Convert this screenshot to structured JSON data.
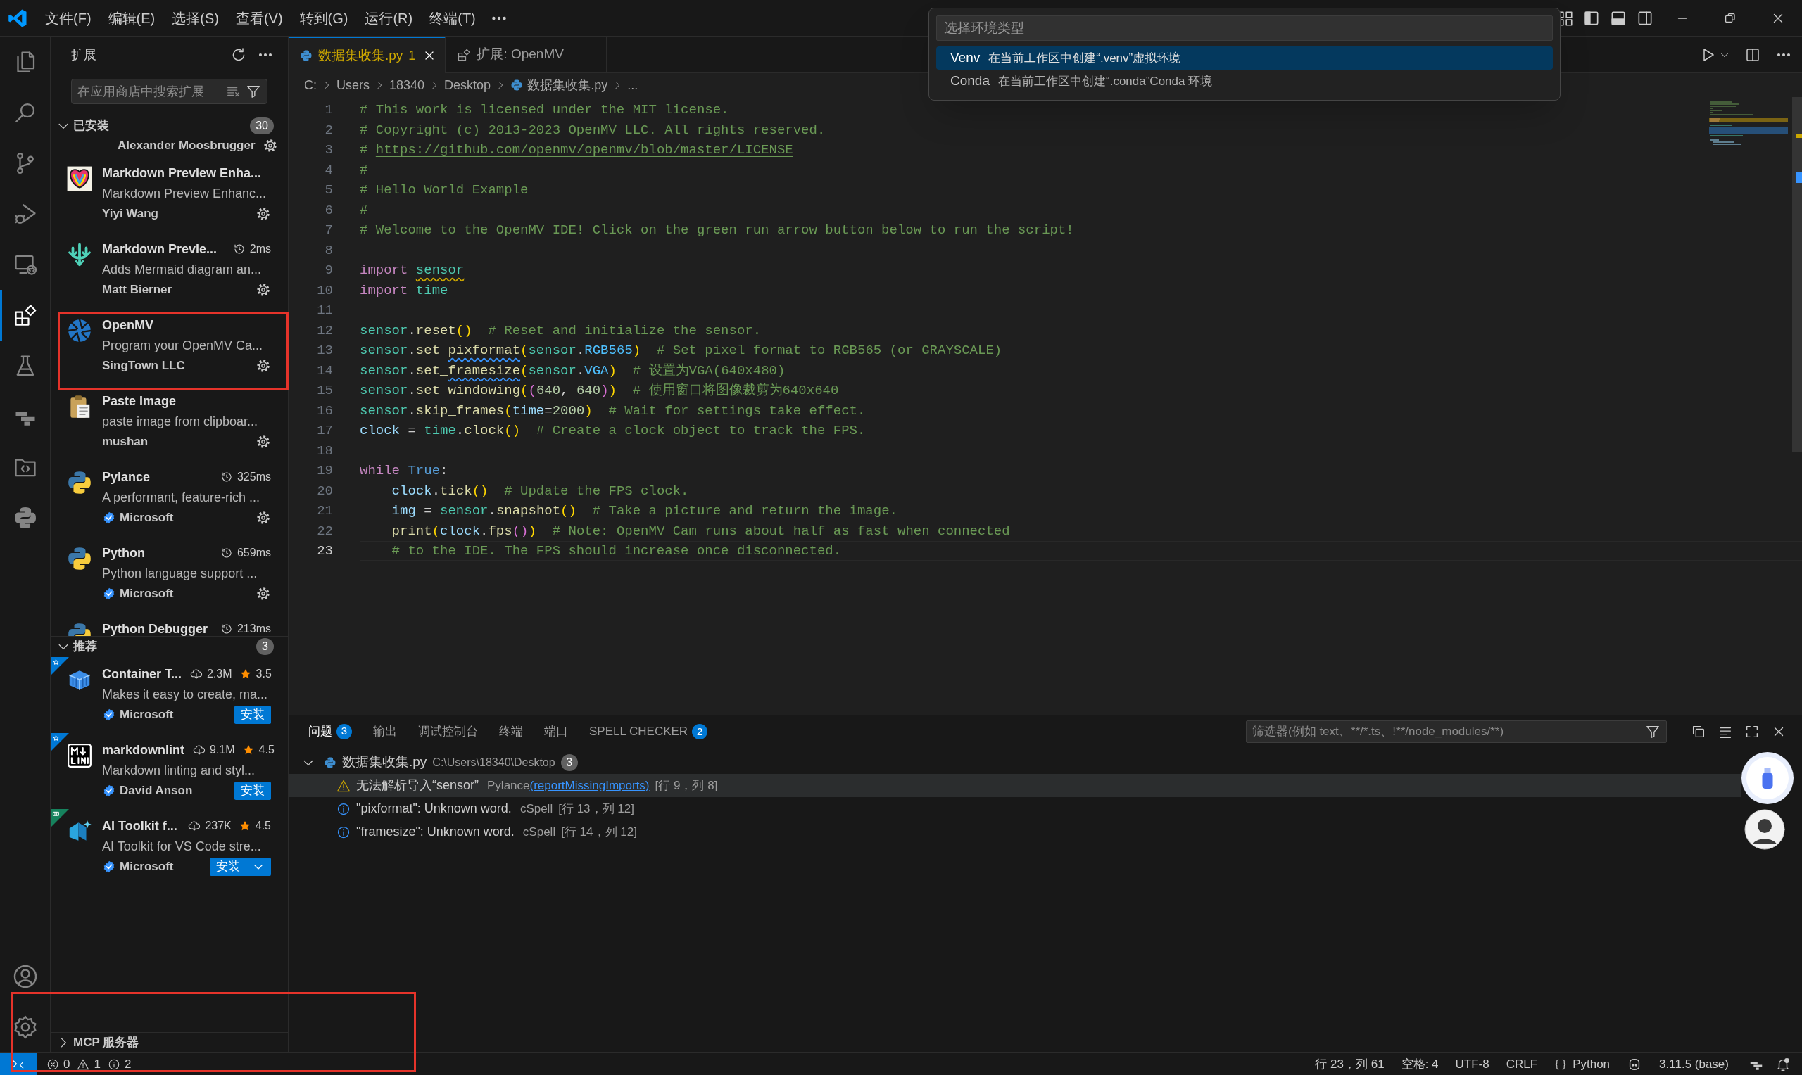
{
  "title_bar": {
    "menu": [
      "文件(F)",
      "编辑(E)",
      "选择(S)",
      "查看(V)",
      "转到(G)",
      "运行(R)",
      "终端(T)"
    ]
  },
  "quick_pick": {
    "placeholder": "选择环境类型",
    "items": [
      {
        "label": "Venv",
        "description": "在当前工作区中创建“.venv”虚拟环境",
        "selected": true
      },
      {
        "label": "Conda",
        "description": "在当前工作区中创建“.conda”Conda 环境",
        "selected": false
      }
    ]
  },
  "activity_bar": {
    "items": [
      {
        "selected": false
      },
      {
        "selected": false
      },
      {
        "selected": false
      },
      {
        "selected": false
      },
      {
        "selected": false
      },
      {
        "selected": true
      },
      {
        "selected": false
      },
      {
        "selected": false
      },
      {
        "selected": false
      },
      {
        "selected": false
      }
    ]
  },
  "sidebar": {
    "title": "扩展",
    "search": {
      "placeholder": "在应用商店中搜索扩展"
    },
    "sections": [
      {
        "title": "已安装",
        "count": "30",
        "expanded": true,
        "items": [
          {
            "publisher": "Alexander Moosbrugger",
            "verified": false,
            "settings": true
          },
          {
            "name": "Markdown Preview Enha...",
            "description": "Markdown Preview Enhanc...",
            "publisher": "Yiyi Wang",
            "verified": false,
            "settings": true
          },
          {
            "name": "Markdown Previe...",
            "time": "2ms",
            "description": "Adds Mermaid diagram an...",
            "publisher": "Matt Bierner",
            "verified": false,
            "settings": true
          },
          {
            "name": "OpenMV",
            "description": "Program your OpenMV Ca...",
            "publisher": "SingTown LLC",
            "verified": false,
            "settings": true
          },
          {
            "name": "Paste Image",
            "description": "paste image from clipboar...",
            "publisher": "mushan",
            "verified": false,
            "settings": true
          },
          {
            "name": "Pylance",
            "time": "325ms",
            "description": "A performant, feature-rich ...",
            "publisher": "Microsoft",
            "verified": true,
            "settings": true
          },
          {
            "name": "Python",
            "time": "659ms",
            "description": "Python language support ...",
            "publisher": "Microsoft",
            "verified": true,
            "settings": true
          },
          {
            "name": "Python Debugger",
            "time": "213ms"
          }
        ]
      },
      {
        "title": "推荐",
        "count": "3",
        "expanded": true,
        "items": [
          {
            "name": "Container T...",
            "downloads": "2.3M",
            "rating": "3.5",
            "description": "Makes it easy to create, ma...",
            "publisher": "Microsoft",
            "verified": true,
            "action": {
              "label": "安装",
              "dropdown": false
            },
            "preview": false
          },
          {
            "name": "markdownlint",
            "downloads": "9.1M",
            "rating": "4.5",
            "description": "Markdown linting and styl...",
            "publisher": "David Anson",
            "verified": true,
            "action": {
              "label": "安装",
              "dropdown": false
            },
            "preview": false
          },
          {
            "name": "AI Toolkit f...",
            "downloads": "237K",
            "rating": "4.5",
            "description": "AI Toolkit for VS Code stre...",
            "publisher": "Microsoft",
            "verified": true,
            "action": {
              "label": "安装",
              "dropdown": true
            },
            "preview": true
          }
        ]
      },
      {
        "title": "MCP 服务器",
        "expanded": false
      }
    ]
  },
  "editor": {
    "tabs": [
      {
        "label": "数据集收集.py",
        "problems": "1",
        "warning": true,
        "selected": true
      },
      {
        "label": "扩展: OpenMV",
        "warning": false,
        "selected": false
      }
    ],
    "breadcrumbs": [
      "C:",
      "Users",
      "18340",
      "Desktop",
      "数据集收集.py",
      "..."
    ],
    "lines": [
      {
        "number": "1",
        "current": false,
        "tokens": [
          {
            "text": "# This work is licensed under the MIT license.",
            "kind": "comment"
          }
        ]
      },
      {
        "number": "2",
        "current": false,
        "tokens": [
          {
            "text": "# Copyright (c) 2013-2023 OpenMV LLC. All rights reserved.",
            "kind": "comment"
          }
        ]
      },
      {
        "number": "3",
        "current": false,
        "tokens": [
          {
            "text": "# ",
            "kind": "comment"
          },
          {
            "text": "https://github.com/openmv/openmv/blob/master/LICENSE",
            "kind": "link"
          }
        ]
      },
      {
        "number": "4",
        "current": false,
        "tokens": [
          {
            "text": "#",
            "kind": "comment"
          }
        ]
      },
      {
        "number": "5",
        "current": false,
        "tokens": [
          {
            "text": "# Hello World Example",
            "kind": "comment"
          }
        ]
      },
      {
        "number": "6",
        "current": false,
        "tokens": [
          {
            "text": "#",
            "kind": "comment"
          }
        ]
      },
      {
        "number": "7",
        "current": false,
        "tokens": [
          {
            "text": "# Welcome to the OpenMV IDE! Click on the green run arrow button below to run the script!",
            "kind": "comment"
          }
        ]
      },
      {
        "number": "8",
        "current": false
      },
      {
        "number": "9",
        "current": false,
        "tokens": [
          {
            "text": "import ",
            "kind": "keyword"
          },
          {
            "text": "sensor",
            "kind": "module",
            "warning": true
          }
        ]
      },
      {
        "number": "10",
        "current": false,
        "tokens": [
          {
            "text": "import ",
            "kind": "keyword"
          },
          {
            "text": "time",
            "kind": "module"
          }
        ]
      },
      {
        "number": "11",
        "current": false
      },
      {
        "number": "12",
        "current": false,
        "tokens": [
          {
            "text": "sensor",
            "kind": "module"
          },
          {
            "text": ".",
            "kind": "plain"
          },
          {
            "text": "reset",
            "kind": "function"
          },
          {
            "text": "()",
            "kind": "bracket"
          },
          {
            "text": "  # Reset and initialize the sensor.",
            "kind": "comment"
          }
        ]
      },
      {
        "number": "13",
        "current": false,
        "tokens": [
          {
            "text": "sensor",
            "kind": "module"
          },
          {
            "text": ".",
            "kind": "plain"
          },
          {
            "text": "set_",
            "kind": "function"
          },
          {
            "text": "pixformat",
            "kind": "function",
            "unknown_word": true
          },
          {
            "text": "(",
            "kind": "bracket"
          },
          {
            "text": "sensor",
            "kind": "module"
          },
          {
            "text": ".",
            "kind": "plain"
          },
          {
            "text": "RGB565",
            "kind": "constant"
          },
          {
            "text": ")",
            "kind": "bracket"
          },
          {
            "text": "  # Set pixel format to RGB565 (or GRAYSCALE)",
            "kind": "comment"
          }
        ]
      },
      {
        "number": "14",
        "current": false,
        "tokens": [
          {
            "text": "sensor",
            "kind": "module"
          },
          {
            "text": ".",
            "kind": "plain"
          },
          {
            "text": "set_",
            "kind": "function"
          },
          {
            "text": "framesize",
            "kind": "function",
            "unknown_word": true
          },
          {
            "text": "(",
            "kind": "bracket"
          },
          {
            "text": "sensor",
            "kind": "module"
          },
          {
            "text": ".",
            "kind": "plain"
          },
          {
            "text": "VGA",
            "kind": "constant"
          },
          {
            "text": ")",
            "kind": "bracket"
          },
          {
            "text": "  # 设置为VGA(640x480)",
            "kind": "comment"
          }
        ]
      },
      {
        "number": "15",
        "current": false,
        "tokens": [
          {
            "text": "sensor",
            "kind": "module"
          },
          {
            "text": ".",
            "kind": "plain"
          },
          {
            "text": "set_windowing",
            "kind": "function"
          },
          {
            "text": "(",
            "kind": "bracket"
          },
          {
            "text": "(",
            "kind": "bracket2"
          },
          {
            "text": "640",
            "kind": "number"
          },
          {
            "text": ", ",
            "kind": "plain"
          },
          {
            "text": "640",
            "kind": "number"
          },
          {
            "text": ")",
            "kind": "bracket2"
          },
          {
            "text": ")",
            "kind": "bracket"
          },
          {
            "text": "  # 使用窗口将图像裁剪为640x640",
            "kind": "comment"
          }
        ]
      },
      {
        "number": "16",
        "current": false,
        "tokens": [
          {
            "text": "sensor",
            "kind": "module"
          },
          {
            "text": ".",
            "kind": "plain"
          },
          {
            "text": "skip_frames",
            "kind": "function"
          },
          {
            "text": "(",
            "kind": "bracket"
          },
          {
            "text": "time",
            "kind": "variable"
          },
          {
            "text": "=",
            "kind": "plain"
          },
          {
            "text": "2000",
            "kind": "number"
          },
          {
            "text": ")",
            "kind": "bracket"
          },
          {
            "text": "  # Wait for settings take effect.",
            "kind": "comment"
          }
        ]
      },
      {
        "number": "17",
        "current": false,
        "tokens": [
          {
            "text": "clock",
            "kind": "variable"
          },
          {
            "text": " = ",
            "kind": "plain"
          },
          {
            "text": "time",
            "kind": "module"
          },
          {
            "text": ".",
            "kind": "plain"
          },
          {
            "text": "clock",
            "kind": "function"
          },
          {
            "text": "()",
            "kind": "bracket"
          },
          {
            "text": "  # Create a clock object to track the FPS.",
            "kind": "comment"
          }
        ]
      },
      {
        "number": "18",
        "current": false
      },
      {
        "number": "19",
        "current": false,
        "tokens": [
          {
            "text": "while ",
            "kind": "keyword"
          },
          {
            "text": "True",
            "kind": "boolean"
          },
          {
            "text": ":",
            "kind": "plain"
          }
        ]
      },
      {
        "number": "20",
        "current": false,
        "tokens": [
          {
            "text": "    clock",
            "kind": "variable"
          },
          {
            "text": ".",
            "kind": "plain"
          },
          {
            "text": "tick",
            "kind": "function"
          },
          {
            "text": "()",
            "kind": "bracket"
          },
          {
            "text": "  # Update the FPS clock.",
            "kind": "comment"
          }
        ]
      },
      {
        "number": "21",
        "current": false,
        "tokens": [
          {
            "text": "    img",
            "kind": "variable"
          },
          {
            "text": " = ",
            "kind": "plain"
          },
          {
            "text": "sensor",
            "kind": "module"
          },
          {
            "text": ".",
            "kind": "plain"
          },
          {
            "text": "snapshot",
            "kind": "function"
          },
          {
            "text": "()",
            "kind": "bracket"
          },
          {
            "text": "  # Take a picture and return the image.",
            "kind": "comment"
          }
        ]
      },
      {
        "number": "22",
        "current": false,
        "tokens": [
          {
            "text": "    print",
            "kind": "function"
          },
          {
            "text": "(",
            "kind": "bracket"
          },
          {
            "text": "clock",
            "kind": "variable"
          },
          {
            "text": ".",
            "kind": "plain"
          },
          {
            "text": "fps",
            "kind": "function"
          },
          {
            "text": "()",
            "kind": "bracket2"
          },
          {
            "text": ")",
            "kind": "bracket"
          },
          {
            "text": "  # Note: OpenMV Cam runs about half as fast when connected",
            "kind": "comment"
          }
        ]
      },
      {
        "number": "23",
        "current": true,
        "tokens": [
          {
            "text": "    # to the IDE. The FPS should increase once disconnected.",
            "kind": "comment"
          }
        ]
      }
    ]
  },
  "panel": {
    "tabs": [
      {
        "label": "问题",
        "count": "3",
        "selected": true
      },
      {
        "label": "输出",
        "selected": false
      },
      {
        "label": "调试控制台",
        "selected": false
      },
      {
        "label": "终端",
        "selected": false
      },
      {
        "label": "端口",
        "selected": false
      },
      {
        "label": "SPELL CHECKER",
        "count": "2",
        "selected": false
      }
    ],
    "filter": {
      "placeholder": "筛选器(例如 text、**/*.ts、!**/node_modules/**)"
    },
    "problems": {
      "file": "数据集收集.py",
      "path": "C:\\Users\\18340\\Desktop",
      "count": "3",
      "expanded": true,
      "items": [
        {
          "kind": "warning",
          "message": "无法解析导入“sensor”",
          "source": "Pylance",
          "code": "(reportMissingImports)",
          "location": "[行 9，列 8]",
          "selected": true
        },
        {
          "kind": "info",
          "message": "\"pixformat\": Unknown word.",
          "source": "cSpell",
          "location": "[行 13，列 12]",
          "selected": false
        },
        {
          "kind": "info",
          "message": "\"framesize\": Unknown word.",
          "source": "cSpell",
          "location": "[行 14，列 12]",
          "selected": false
        }
      ]
    }
  },
  "status_bar": {
    "errors": "0",
    "warnings": "1",
    "infos": "2",
    "position": "行 23，列 61",
    "indentation": "空格: 4",
    "encoding": "UTF-8",
    "eol": "CRLF",
    "language": "Python",
    "interpreter": "3.11.5 (base)",
    "unread_notifications": true
  }
}
